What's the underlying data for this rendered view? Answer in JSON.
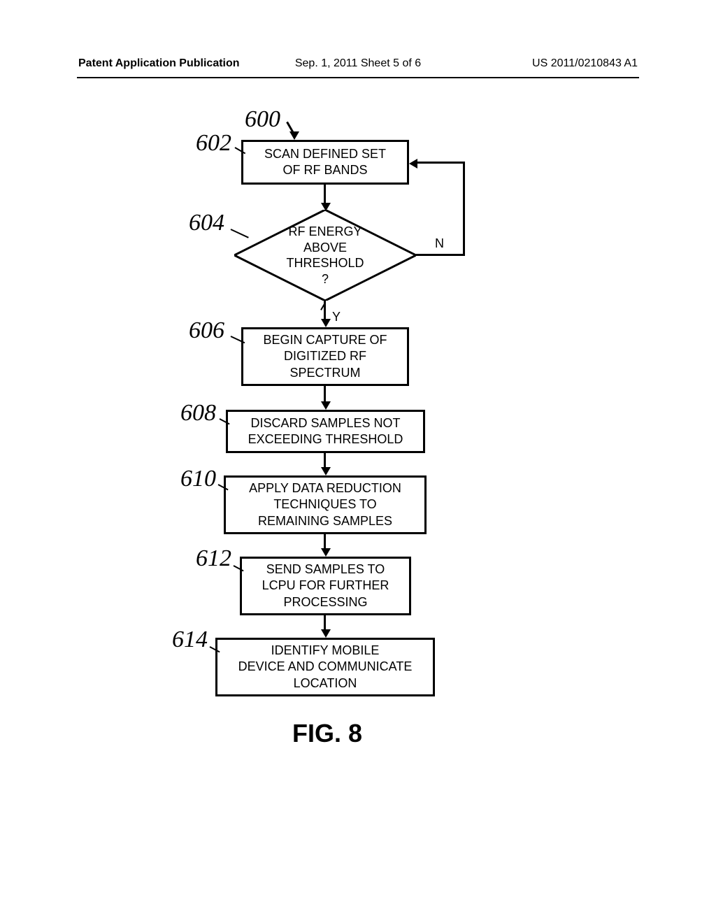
{
  "header": {
    "left": "Patent Application Publication",
    "center": "Sep. 1, 2011  Sheet 5 of 6",
    "right": "US 2011/0210843 A1"
  },
  "refs": {
    "r600": "600",
    "r602": "602",
    "r604": "604",
    "r606": "606",
    "r608": "608",
    "r610": "610",
    "r612": "612",
    "r614": "614"
  },
  "boxes": {
    "b602": "SCAN DEFINED SET\nOF RF BANDS",
    "b604": "RF ENERGY\nABOVE\nTHRESHOLD\n?",
    "b606": "BEGIN CAPTURE OF\nDIGITIZED RF\nSPECTRUM",
    "b608": "DISCARD SAMPLES NOT\nEXCEEDING THRESHOLD",
    "b610": "APPLY DATA REDUCTION\nTECHNIQUES TO\nREMAINING SAMPLES",
    "b612": "SEND SAMPLES TO\nLCPU FOR FURTHER\nPROCESSING",
    "b614": "IDENTIFY MOBILE\nDEVICE AND COMMUNICATE\nLOCATION"
  },
  "labels": {
    "yes": "Y",
    "no": "N",
    "figure": "FIG. 8"
  }
}
